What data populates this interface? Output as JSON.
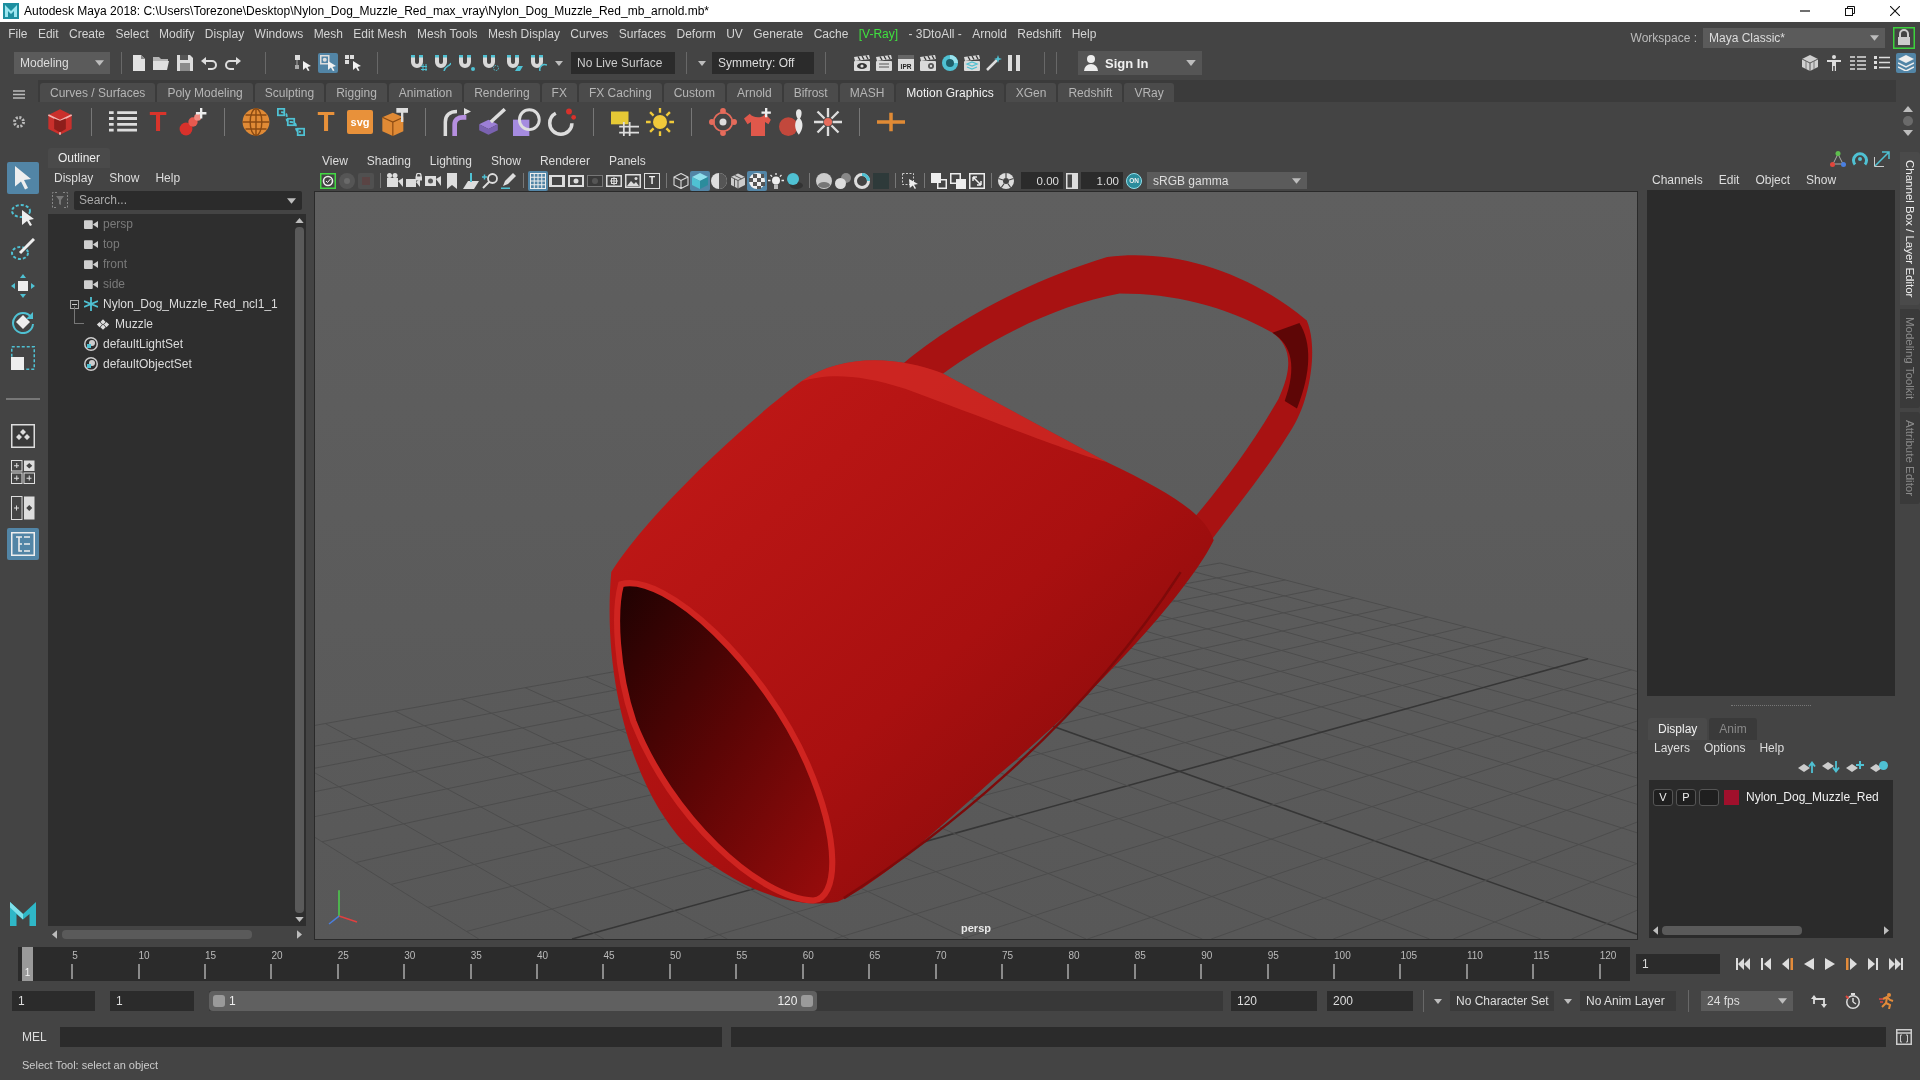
{
  "window": {
    "title": "Autodesk Maya 2018: C:\\Users\\Torezone\\Desktop\\Nylon_Dog_Muzzle_Red_max_vray\\Nylon_Dog_Muzzle_Red_mb_arnold.mb*"
  },
  "menu_bar": [
    {
      "label": "File",
      "kind": "plain"
    },
    {
      "label": "Edit",
      "kind": "plain"
    },
    {
      "label": "Create",
      "kind": "plain"
    },
    {
      "label": "Select",
      "kind": "plain"
    },
    {
      "label": "Modify",
      "kind": "plain"
    },
    {
      "label": "Display",
      "kind": "plain"
    },
    {
      "label": "Windows",
      "kind": "plain"
    },
    {
      "label": "Mesh",
      "kind": "plain"
    },
    {
      "label": "Edit Mesh",
      "kind": "plain"
    },
    {
      "label": "Mesh Tools",
      "kind": "plain"
    },
    {
      "label": "Mesh Display",
      "kind": "plain"
    },
    {
      "label": "Curves",
      "kind": "plain"
    },
    {
      "label": "Surfaces",
      "kind": "plain"
    },
    {
      "label": "Deform",
      "kind": "plain"
    },
    {
      "label": "UV",
      "kind": "plain"
    },
    {
      "label": "Generate",
      "kind": "plain"
    },
    {
      "label": "Cache",
      "kind": "plain"
    },
    {
      "label": "[V-Ray]",
      "kind": "plugin"
    },
    {
      "label": "- 3DtoAll -",
      "kind": "plain"
    },
    {
      "label": "Arnold",
      "kind": "plain"
    },
    {
      "label": "Redshift",
      "kind": "plain"
    },
    {
      "label": "Help",
      "kind": "plain"
    }
  ],
  "workspace": {
    "label": "Workspace :",
    "value": "Maya Classic*"
  },
  "status_line": {
    "mode": "Modeling",
    "select_tools": [
      {
        "selected": false
      },
      {
        "selected": true
      },
      {
        "selected": false
      }
    ],
    "live_surface": "No Live Surface",
    "symmetry": "Symmetry: Off",
    "ipr_label": "IPR",
    "sign_in": "Sign In",
    "panel_toggles": [
      {
        "selected": false
      },
      {
        "selected": false
      },
      {
        "selected": false
      },
      {
        "selected": false
      },
      {
        "selected": true
      }
    ]
  },
  "shelf": {
    "tabs": [
      {
        "label": "Curves / Surfaces",
        "selected": false
      },
      {
        "label": "Poly Modeling",
        "selected": false
      },
      {
        "label": "Sculpting",
        "selected": false
      },
      {
        "label": "Rigging",
        "selected": false
      },
      {
        "label": "Animation",
        "selected": false
      },
      {
        "label": "Rendering",
        "selected": false
      },
      {
        "label": "FX",
        "selected": false
      },
      {
        "label": "FX Caching",
        "selected": false
      },
      {
        "label": "Custom",
        "selected": false
      },
      {
        "label": "Arnold",
        "selected": false
      },
      {
        "label": "Bifrost",
        "selected": false
      },
      {
        "label": "MASH",
        "selected": false
      },
      {
        "label": "Motion Graphics",
        "selected": true
      },
      {
        "label": "XGen",
        "selected": false
      },
      {
        "label": "Redshift",
        "selected": false
      },
      {
        "label": "VRay",
        "selected": false
      }
    ],
    "glyphs": [
      {
        "kind": "letter",
        "text": "T",
        "color": "#d9342b"
      },
      {
        "kind": "letter",
        "text": "T",
        "color": "#e8913a"
      },
      {
        "kind": "tile",
        "text": "svg",
        "color": "#e8913a"
      }
    ]
  },
  "toolbox": {
    "tools": [
      {
        "selected": true
      },
      {
        "selected": false
      },
      {
        "selected": false
      },
      {
        "selected": false
      },
      {
        "selected": false
      },
      {
        "selected": false
      }
    ],
    "layouts": [
      {
        "selected": false
      },
      {
        "selected": false
      },
      {
        "selected": false
      },
      {
        "selected": true
      }
    ]
  },
  "outliner": {
    "tab": "Outliner",
    "menus": [
      "Display",
      "Show",
      "Help"
    ],
    "search": {
      "placeholder": "Search..."
    },
    "items": [
      {
        "label": "persp",
        "kind": "camera",
        "dimmed": true
      },
      {
        "label": "top",
        "kind": "camera",
        "dimmed": true
      },
      {
        "label": "front",
        "kind": "camera",
        "dimmed": true
      },
      {
        "label": "side",
        "kind": "camera",
        "dimmed": true
      },
      {
        "label": "Nylon_Dog_Muzzle_Red_ncl1_1",
        "kind": "group",
        "dimmed": false,
        "expanded": true,
        "children": [
          {
            "label": "Muzzle",
            "kind": "mesh",
            "dimmed": false
          }
        ]
      },
      {
        "label": "defaultLightSet",
        "kind": "set",
        "dimmed": false
      },
      {
        "label": "defaultObjectSet",
        "kind": "set",
        "dimmed": false
      }
    ]
  },
  "viewport": {
    "menus": [
      "View",
      "Shading",
      "Lighting",
      "Show",
      "Renderer",
      "Panels"
    ],
    "tools": [
      {
        "selected": false
      },
      {
        "selected": false
      },
      {
        "selected": false
      },
      {
        "selected": false
      },
      {
        "selected": false
      },
      {
        "selected": false
      },
      {
        "selected": false
      },
      {
        "selected": false
      },
      {
        "selected": false
      },
      {
        "selected": false
      },
      {
        "selected": true
      },
      {
        "selected": false
      },
      {
        "selected": false
      },
      {
        "selected": false
      },
      {
        "selected": false
      },
      {
        "selected": false
      },
      {
        "selected": false,
        "text": "T"
      },
      {
        "selected": false
      },
      {
        "selected": true
      },
      {
        "selected": false
      },
      {
        "selected": false
      },
      {
        "selected": true
      },
      {
        "selected": false
      },
      {
        "selected": false
      },
      {
        "selected": false
      },
      {
        "selected": false
      },
      {
        "selected": false
      },
      {
        "selected": false
      },
      {
        "selected": false
      },
      {
        "selected": false
      },
      {
        "selected": false
      },
      {
        "selected": false
      },
      {
        "selected": false
      }
    ],
    "exposure": "0.00",
    "gamma": "1.00",
    "color_management": "ON",
    "color_space": "sRGB gamma",
    "camera_label": "persp"
  },
  "channel_box": {
    "menus": [
      "Channels",
      "Edit",
      "Object",
      "Show"
    ]
  },
  "side_tabs": [
    {
      "label": "Channel Box / Layer Editor",
      "selected": true
    },
    {
      "label": "Modeling Toolkit",
      "selected": false
    },
    {
      "label": "Attribute Editor",
      "selected": false
    }
  ],
  "layer_editor": {
    "tabs": [
      {
        "label": "Display",
        "selected": true
      },
      {
        "label": "Anim",
        "selected": false
      }
    ],
    "menus": [
      "Layers",
      "Options",
      "Help"
    ],
    "layers": [
      {
        "visibility": "V",
        "playback": "P",
        "color": "#a0102c",
        "name": "Nylon_Dog_Muzzle_Red"
      }
    ]
  },
  "time_slider": {
    "level": 0,
    "current_frame": "1",
    "ticks": [
      "5",
      "10",
      "15",
      "20",
      "25",
      "30",
      "35",
      "40",
      "45",
      "50",
      "55",
      "60",
      "65",
      "70",
      "75",
      "80",
      "85",
      "90",
      "95",
      "100",
      "105",
      "110",
      "115",
      "120"
    ],
    "frame_field": "1"
  },
  "range_slider": {
    "start": "1",
    "playback_start": "1",
    "range_start": "1",
    "range_end": "120",
    "level": 0.6,
    "playback_end": "120",
    "end": "200",
    "character_set": "No Character Set",
    "anim_layer": "No Anim Layer",
    "fps": "24 fps"
  },
  "command_line": {
    "language": "MEL"
  },
  "help_line": {
    "text": "Select Tool: select an object"
  }
}
